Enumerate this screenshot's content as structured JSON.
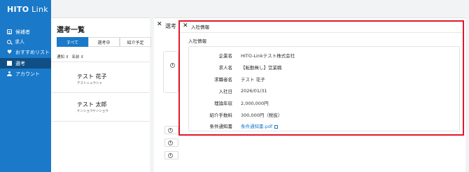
{
  "app": {
    "logo_main": "HITO",
    "logo_sub": " Link"
  },
  "sidebar": {
    "items": [
      {
        "label": "候補者",
        "icon": "list-icon"
      },
      {
        "label": "求人",
        "icon": "search-icon"
      },
      {
        "label": "おすすめリスト",
        "icon": "heart-icon"
      },
      {
        "label": "選考",
        "icon": "document-icon",
        "active": true
      },
      {
        "label": "アカウント",
        "icon": "person-icon"
      }
    ]
  },
  "list": {
    "title": "選考一覧",
    "tabs": [
      {
        "label": "すべて",
        "active": true
      },
      {
        "label": "選考中"
      },
      {
        "label": "紹介予定"
      }
    ],
    "columns": {
      "notify": "通知 ⇕",
      "name": "名前 ⇕"
    },
    "people": [
      {
        "name": "テスト 花子",
        "kana": "テストニュウシャ"
      },
      {
        "name": "テスト 太郎",
        "kana": "ケンショウケンショウ"
      }
    ]
  },
  "detail": {
    "title": "選考"
  },
  "modal": {
    "title": "入社情報",
    "section": "入社情報",
    "rows": [
      {
        "label": "企業名",
        "value": "HITO-Linkテスト株式会社"
      },
      {
        "label": "求人名",
        "value": "【転勤無し】営業職"
      },
      {
        "label": "求職者名",
        "value": "テスト 花子"
      },
      {
        "label": "入社日",
        "value": "2026/01/31"
      },
      {
        "label": "理論年収",
        "value": "2,000,000円"
      },
      {
        "label": "紹介手数料",
        "value": "300,000円（税抜）"
      },
      {
        "label": "条件通知書",
        "value": "条件通知書.pdf",
        "link": true
      }
    ]
  },
  "colors": {
    "brand": "#1a79c9",
    "sidebar_active": "#0f4f85",
    "highlight": "#e0192b",
    "link": "#1a79c9"
  }
}
